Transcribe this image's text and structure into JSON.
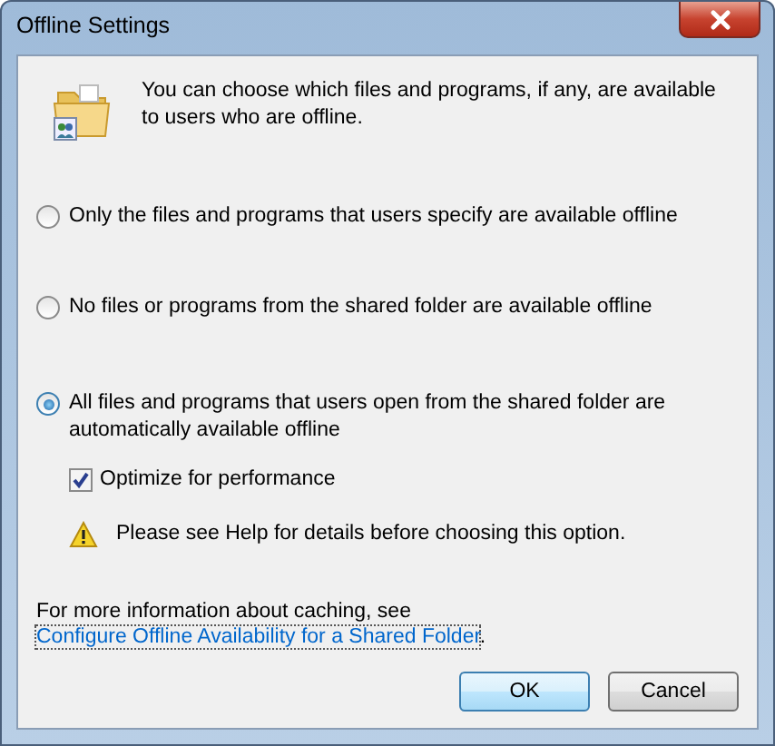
{
  "window": {
    "title": "Offline Settings"
  },
  "intro": "You can choose which files and programs, if any, are available to users who are offline.",
  "options": [
    {
      "label": "Only the files and programs that users specify are available offline",
      "selected": false
    },
    {
      "label": "No files or programs from the shared folder are available offline",
      "selected": false
    },
    {
      "label": "All files and programs that users open from the shared folder are automatically available offline",
      "selected": true
    }
  ],
  "optimize": {
    "label": "Optimize for performance",
    "checked": true
  },
  "warning": "Please see Help for details before choosing this option.",
  "info": {
    "text": "For more information about caching, see",
    "link": "Configure Offline Availability for a Shared Folder",
    "after": "."
  },
  "buttons": [
    {
      "label": "OK",
      "default": true
    },
    {
      "label": "Cancel",
      "default": false
    }
  ]
}
